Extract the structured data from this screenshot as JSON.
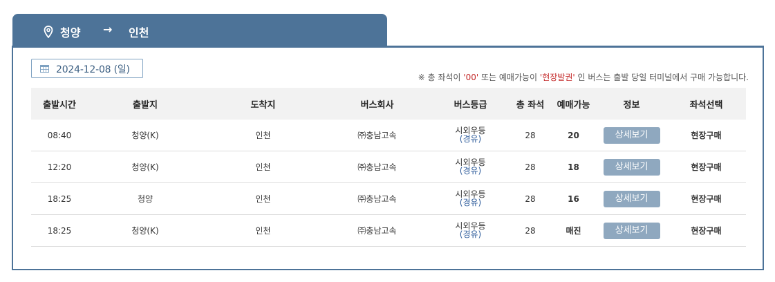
{
  "route": {
    "from": "청양",
    "arrow": "→",
    "to": "인천"
  },
  "date": "2024-12-08 (일)",
  "notice": {
    "part1": "※ 총 좌석이 ",
    "zero": "'00'",
    "part2": " 또는 예매가능이 ",
    "onsite": "'현장발권'",
    "part3": " 인 버스는 출발 당일 터미널에서 구매 가능합니다."
  },
  "columns": [
    "출발시간",
    "출발지",
    "도착지",
    "버스회사",
    "버스등급",
    "총 좌석",
    "예매가능",
    "정보",
    "좌석선택"
  ],
  "rows": [
    {
      "time": "08:40",
      "origin": "청양(K)",
      "dest": "인천",
      "company": "㈜충남고속",
      "grade": "시외우등",
      "grade_sub": "(경유)",
      "seats": "28",
      "available": "20",
      "info": "상세보기",
      "select": "현장구매"
    },
    {
      "time": "12:20",
      "origin": "청양(K)",
      "dest": "인천",
      "company": "㈜충남고속",
      "grade": "시외우등",
      "grade_sub": "(경유)",
      "seats": "28",
      "available": "18",
      "info": "상세보기",
      "select": "현장구매"
    },
    {
      "time": "18:25",
      "origin": "청양",
      "dest": "인천",
      "company": "㈜충남고속",
      "grade": "시외우등",
      "grade_sub": "(경유)",
      "seats": "28",
      "available": "16",
      "info": "상세보기",
      "select": "현장구매"
    },
    {
      "time": "18:25",
      "origin": "청양(K)",
      "dest": "인천",
      "company": "㈜충남고속",
      "grade": "시외우등",
      "grade_sub": "(경유)",
      "seats": "28",
      "available": "매진",
      "info": "상세보기",
      "select": "현장구매"
    }
  ],
  "colors": {
    "accent": "#4d7398",
    "button": "#8fa8bf",
    "notice_red": "#c42a2a"
  },
  "icons": {
    "route": "map-pin-icon",
    "arrow": "arrow-right-icon",
    "date": "calendar-icon"
  }
}
